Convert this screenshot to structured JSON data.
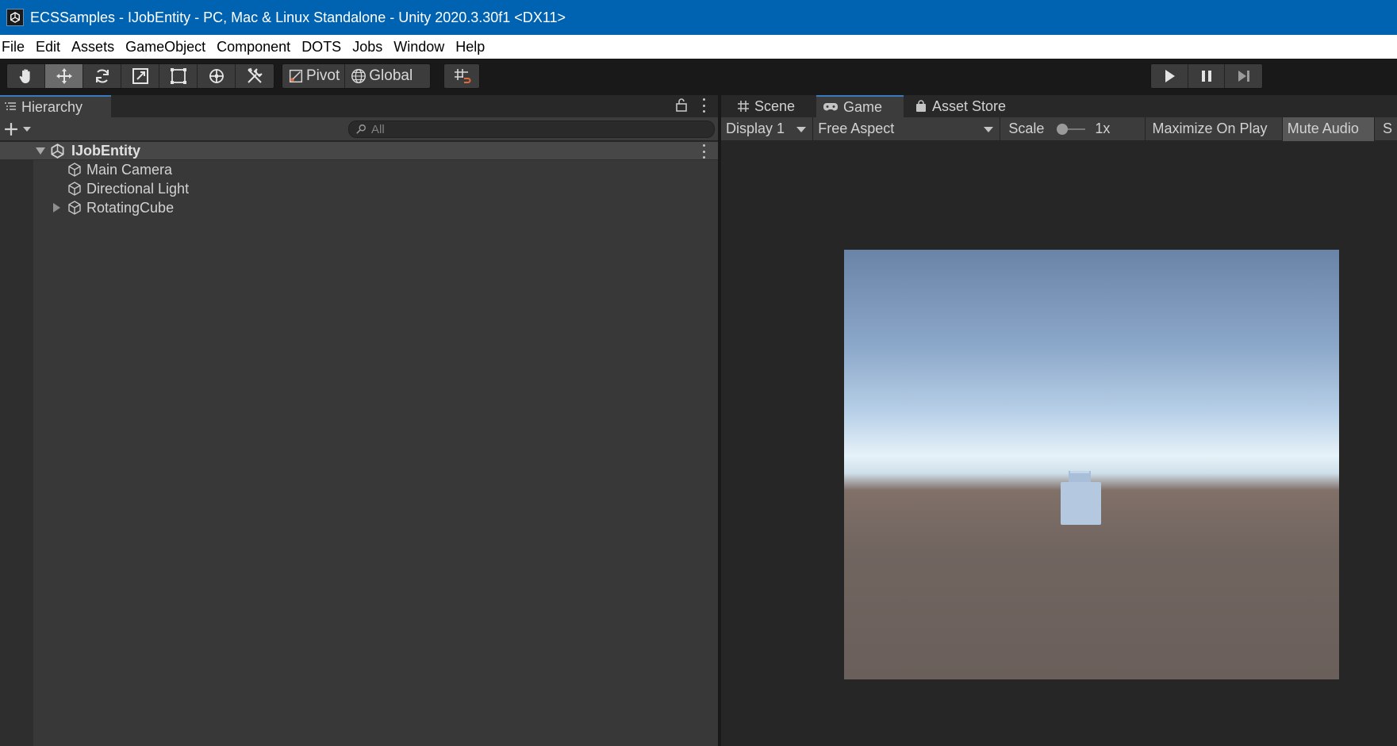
{
  "window": {
    "title": "ECSSamples - IJobEntity - PC, Mac & Linux Standalone - Unity 2020.3.30f1 <DX11>"
  },
  "menu": {
    "items": [
      "File",
      "Edit",
      "Assets",
      "GameObject",
      "Component",
      "DOTS",
      "Jobs",
      "Window",
      "Help"
    ]
  },
  "toolbar": {
    "tools": [
      "hand-tool",
      "move-tool",
      "rotate-tool",
      "scale-tool",
      "rect-tool",
      "transform-tool",
      "custom-tool"
    ],
    "active_tool": "move-tool",
    "pivot_label": "Pivot",
    "global_label": "Global",
    "accent_color": "#e06a3c"
  },
  "hierarchy": {
    "tab_label": "Hierarchy",
    "search_placeholder": "All",
    "scene": "IJobEntity",
    "objects": [
      {
        "name": "Main Camera",
        "has_children": false
      },
      {
        "name": "Directional Light",
        "has_children": false
      },
      {
        "name": "RotatingCube",
        "has_children": true
      }
    ]
  },
  "game_panel": {
    "tabs": {
      "scene": "Scene",
      "game": "Game",
      "asset_store": "Asset Store"
    },
    "active_tab": "Game",
    "display": "Display 1",
    "aspect": "Free Aspect",
    "scale_label": "Scale",
    "scale_value": "1x",
    "maximize_on_play": "Maximize On Play",
    "mute_audio": "Mute Audio",
    "truncated_label": "S"
  },
  "colors": {
    "titlebar": "#0063b1",
    "panel": "#383838",
    "cube": "#b4c8e0"
  }
}
